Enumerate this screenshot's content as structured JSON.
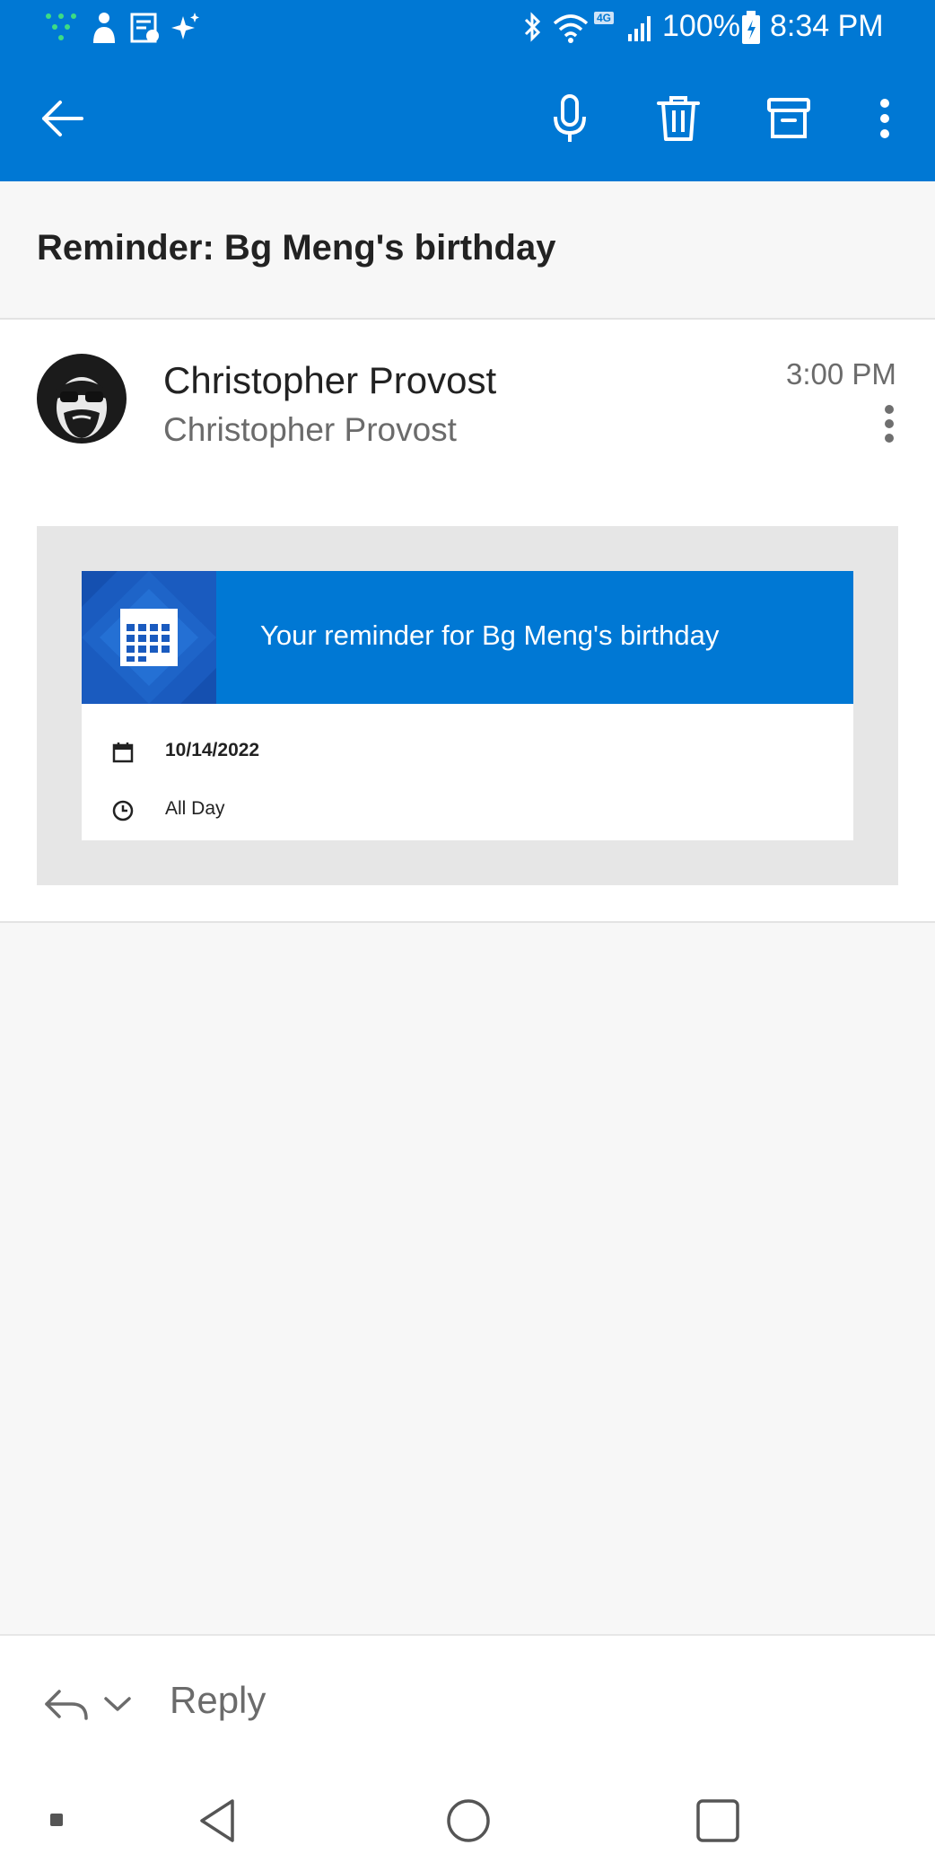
{
  "status_bar": {
    "battery": "100%",
    "time": "8:34 PM",
    "network_badge": "4G"
  },
  "toolbar": {
    "icons": [
      "back-arrow-icon",
      "microphone-icon",
      "trash-icon",
      "archive-icon",
      "overflow-menu-icon"
    ]
  },
  "subject": "Reminder: Bg Meng's birthday",
  "message": {
    "sender_name": "Christopher Provost",
    "recipient_name": "Christopher Provost",
    "time": "3:00 PM",
    "card": {
      "title": "Your reminder for Bg Meng's birthday",
      "date": "10/14/2022",
      "time": "All Day"
    }
  },
  "reply": {
    "label": "Reply"
  },
  "colors": {
    "accent": "#0078d4",
    "card_icon_bg": "#1a5bbf",
    "background": "#f7f7f7"
  }
}
